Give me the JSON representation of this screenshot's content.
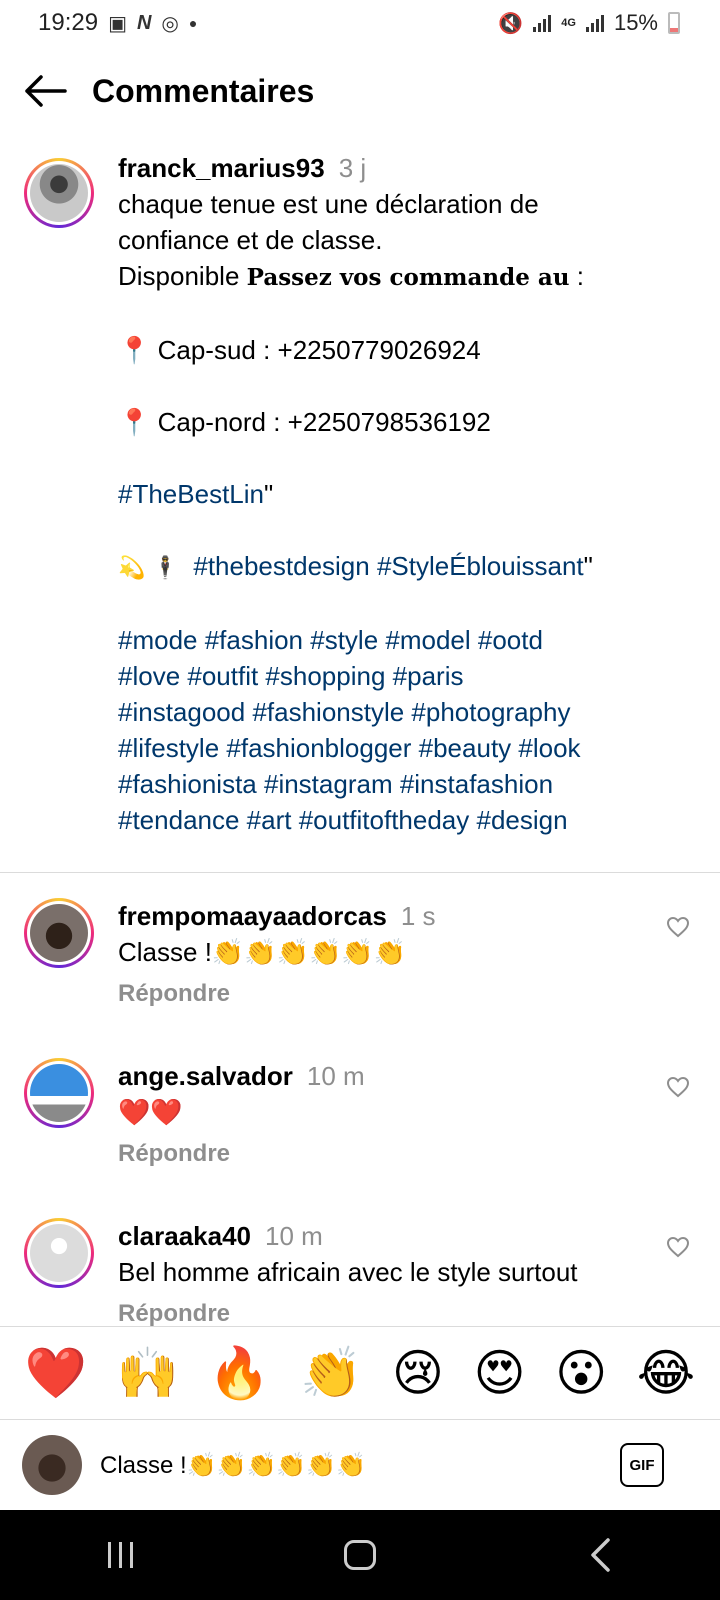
{
  "status_bar": {
    "time": "19:29",
    "left_icons": [
      "image-icon",
      "n-icon",
      "sync-icon",
      "dot-icon"
    ],
    "network": "4G",
    "battery": "15%"
  },
  "header": {
    "title": "Commentaires"
  },
  "caption": {
    "username": "franck_marius93",
    "time": "3 j",
    "line1": "chaque tenue est une déclaration de",
    "line2": "confiance et de classe.",
    "line3_a": "Disponible ",
    "line3_b": "Passez vos commande au",
    "line3_c": " :",
    "pin1": "📍 Cap-sud : +2250779026924",
    "pin2": "📍 Cap-nord : +2250798536192",
    "tag_line1_tag": "#TheBestLin",
    "tag_line1_rest": "\"",
    "tag_line2_emoji": "💫 🕴",
    "tag_line2_tags": "#thebestdesign #StyleÉblouissant",
    "tag_line2_rest": "\"",
    "hashtag_lines": [
      "#mode #fashion #style #model #ootd",
      "#love #outfit #shopping #paris",
      "#instagood #fashionstyle #photography",
      "#lifestyle #fashionblogger #beauty #look",
      "#fashionista #instagram #instafashion",
      "#tendance #art #outfitoftheday #design"
    ]
  },
  "comments": [
    {
      "username": "frempomaayaadorcas",
      "time": "1 s",
      "text": "Classe !👏👏👏👏👏👏",
      "reply": "Répondre"
    },
    {
      "username": "ange.salvador",
      "time": "10 m",
      "text": "❤️❤️",
      "reply": "Répondre"
    },
    {
      "username": "claraaka40",
      "time": "10 m",
      "text": "Bel homme africain avec le style surtout",
      "reply": "Répondre"
    }
  ],
  "emoji_bar": [
    "❤️",
    "🙌",
    "🔥",
    "👏",
    "😢",
    "😍",
    "😮",
    "😂"
  ],
  "input": {
    "value": "Classe !👏👏👏👏👏👏",
    "gif_label": "GIF"
  },
  "colors": {
    "hashtag": "#00376b",
    "muted": "#8e8e8e",
    "divider": "#dbdbdb"
  }
}
